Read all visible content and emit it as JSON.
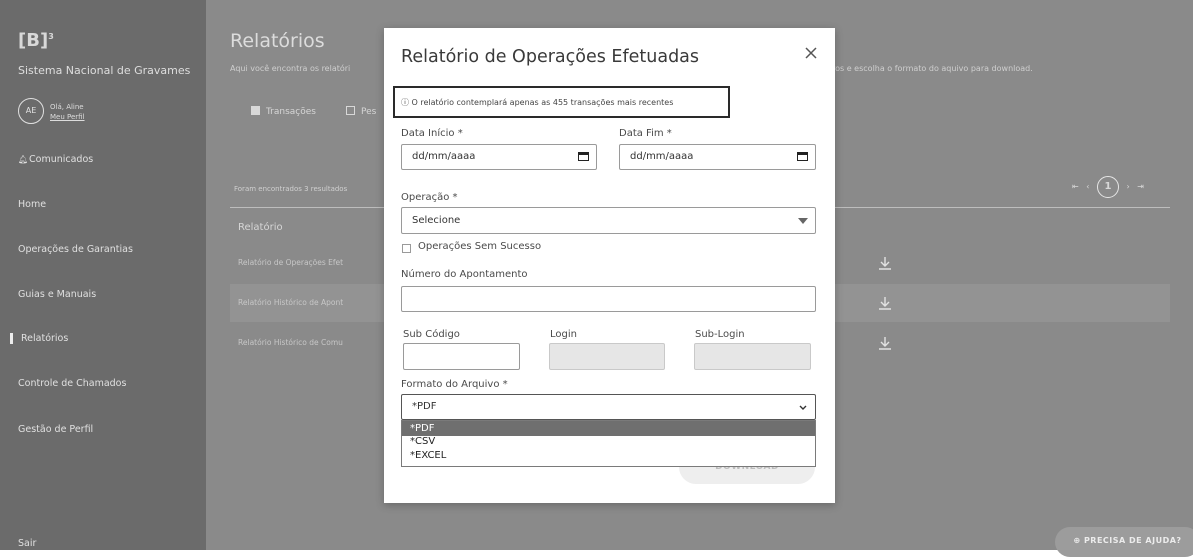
{
  "sidebar": {
    "logo": "[B]",
    "logo_sup": "3",
    "app_name": "Sistema Nacional de Gravames",
    "avatar_initials": "AE",
    "greeting": "Olá, Aline",
    "profile_link": "Meu Perfil",
    "items": [
      {
        "label": "Comunicados"
      },
      {
        "label": "Home"
      },
      {
        "label": "Operações de Garantias"
      },
      {
        "label": "Guias e Manuais"
      },
      {
        "label": "Relatórios"
      },
      {
        "label": "Controle de Chamados"
      },
      {
        "label": "Gestão de Perfil"
      }
    ],
    "logout": "Sair"
  },
  "main": {
    "title": "Relatórios",
    "subtitle_left": "Aqui você encontra os relatóri",
    "subtitle_right": "ros e escolha o formato do aquivo para download.",
    "filters": [
      {
        "label": "Transações",
        "checked": true
      },
      {
        "label": "Pes",
        "checked": false
      }
    ],
    "results_count": "Foram encontrados 3 resultados",
    "pager": {
      "first": "⇤",
      "prev": "‹",
      "current": "1",
      "next": "›",
      "last": "⇥"
    },
    "table": {
      "header": "Relatório",
      "rows": [
        {
          "label": "Relatório de Operações Efet"
        },
        {
          "label": "Relatório Histórico de Apont"
        },
        {
          "label": "Relatório Histórico de Comu"
        }
      ]
    },
    "help_button": "⊕ PRECISA DE AJUDA?"
  },
  "modal": {
    "title": "Relatório de Operações Efetuadas",
    "notice": "ⓘ O relatório contemplará apenas as 455 transações mais recentes",
    "data_inicio_label": "Data Início *",
    "data_inicio_placeholder": "dd/mm/aaaa",
    "data_fim_label": "Data Fim *",
    "data_fim_placeholder": "dd/mm/aaaa",
    "operacao_label": "Operação *",
    "operacao_value": "Selecione",
    "sem_sucesso_label": "Operações Sem Sucesso",
    "numero_label": "Número do Apontamento",
    "sub_codigo_label": "Sub Código",
    "login_label": "Login",
    "sub_login_label": "Sub-Login",
    "formato_label": "Formato do Arquivo *",
    "formato_value": "*PDF",
    "formato_options": [
      "*PDF",
      "*CSV",
      "*EXCEL"
    ],
    "download_button": "DOWNLOAD"
  },
  "colors": {
    "overlay_sidebar": "#6b6b6b",
    "overlay_main": "#8a8a8a",
    "modal_bg": "#ffffff",
    "option_selected": "#6f6f6f"
  }
}
